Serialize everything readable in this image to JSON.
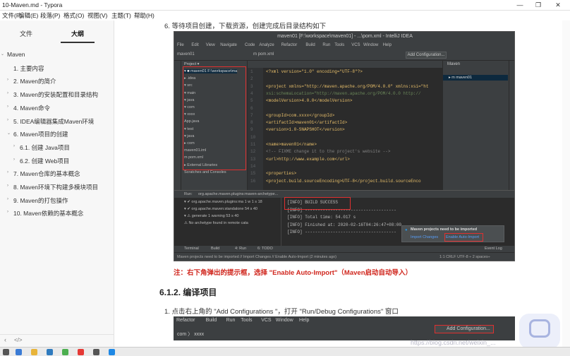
{
  "window": {
    "title": "10-Maven.md - Typora",
    "min": "—",
    "max": "❐",
    "close": "✕"
  },
  "menu": [
    "文件(F)",
    "编辑(E)",
    "段落(P)",
    "格式(O)",
    "视图(V)",
    "主题(T)",
    "帮助(H)"
  ],
  "sidebar": {
    "tab_files": "文件",
    "tab_outline": "大纲",
    "outline": [
      {
        "label": "Maven",
        "caret": "⌄",
        "level": 0
      },
      {
        "label": "1. 主要内容",
        "caret": "",
        "level": 1
      },
      {
        "label": "2. Maven的简介",
        "caret": "›",
        "level": 1
      },
      {
        "label": "3. Maven的安装配置和目录结构",
        "caret": "›",
        "level": 1
      },
      {
        "label": "4. Maven命令",
        "caret": "›",
        "level": 1
      },
      {
        "label": "5. IDEA编辑器集成Maven环境",
        "caret": "›",
        "level": 1
      },
      {
        "label": "6. Maven项目的创建",
        "caret": "⌄",
        "level": 1
      },
      {
        "label": "6.1. 创建 Java项目",
        "caret": "›",
        "level": 2
      },
      {
        "label": "6.2. 创建 Web项目",
        "caret": "›",
        "level": 2
      },
      {
        "label": "7. Maven仓库的基本概念",
        "caret": "›",
        "level": 1
      },
      {
        "label": "8. Maven环境下构建多模块项目",
        "caret": "›",
        "level": 1
      },
      {
        "label": "9. Maven的打包操作",
        "caret": "›",
        "level": 1
      },
      {
        "label": "10. Maven依赖的基本概念",
        "caret": "›",
        "level": 1
      }
    ],
    "footer_prev": "‹",
    "footer_code": "</>"
  },
  "doc": {
    "step6": "6. 等待项目创建，下载资源，创建完成后目录结构如下",
    "note": "注：右下角弹出的提示框，选择 \"Enable Auto-Import\"（Maven启动自动导入）",
    "h612": "6.1.2. 编译项目",
    "step1": "1. 点击右上角的 \"Add Configurations \"，打开 \"Run/Debug Configurations\" 窗口"
  },
  "ide": {
    "title": "maven01 [F:\\workspace\\maven01] - ...\\pom.xml - IntelliJ IDEA",
    "menu": [
      "File",
      "Edit",
      "View",
      "Navigate",
      "Code",
      "Analyze",
      "Refactor",
      "Build",
      "Run",
      "Tools",
      "VCS",
      "Window",
      "Help"
    ],
    "breadcrumb": "maven01",
    "file_tab": "m pom.xml",
    "add_config": "Add Configuration...",
    "project_label": "Project ▾",
    "tree": [
      "▾ ■ maven01  F:\\workspace\\ma",
      "  ▸ .idea",
      "  ▾ src",
      "    ▾ main",
      "      ▾ java",
      "        ▾ com",
      "          ▾ xxxx",
      "              App.java",
      "    ▾ test",
      "      ▾ java",
      "        ▸ com",
      "    maven01.iml",
      "    m pom.xml",
      "▸ External Libraries",
      "  Scratches and Consoles"
    ],
    "code": [
      {
        "t": "<?xml version=\"1.0\" encoding=\"UTF-8\"?>",
        "c": "#e8bf6a"
      },
      {
        "t": "",
        "c": "#a9b7c6"
      },
      {
        "t": "<project xmlns=\"http://maven.apache.org/POM/4.0.0\" xmlns:xsi=\"ht",
        "c": "#e8bf6a"
      },
      {
        "t": "  xsi:schemaLocation=\"http://maven.apache.org/POM/4.0.0 http://",
        "c": "#6a8759"
      },
      {
        "t": "  <modelVersion>4.0.0</modelVersion>",
        "c": "#e8bf6a"
      },
      {
        "t": "",
        "c": "#a9b7c6"
      },
      {
        "t": "  <groupId>com.xxxx</groupId>",
        "c": "#e8bf6a"
      },
      {
        "t": "  <artifactId>maven01</artifactId>",
        "c": "#e8bf6a"
      },
      {
        "t": "  <version>1.0-SNAPSHOT</version>",
        "c": "#e8bf6a"
      },
      {
        "t": "",
        "c": "#a9b7c6"
      },
      {
        "t": "  <name>maven01</name>",
        "c": "#e8bf6a"
      },
      {
        "t": "  <!-- FIXME change it to the project's website -->",
        "c": "#808080"
      },
      {
        "t": "  <url>http://www.example.com</url>",
        "c": "#e8bf6a"
      },
      {
        "t": "",
        "c": "#a9b7c6"
      },
      {
        "t": "  <properties>",
        "c": "#e8bf6a"
      },
      {
        "t": "    <project.build.sourceEncoding>UTF-8</project.build.sourceEnco",
        "c": "#e8bf6a"
      }
    ],
    "maven_title": "Maven",
    "maven_item": "▸ m maven01",
    "run_label": "Run:",
    "run_tab": "org.apache.maven.plugins:maven-archetype...",
    "run_tree": [
      "▾ ✔ org.apache.maven.plugins:ma 1 w 1 s 18",
      "  ▾ ✔ org.apache.maven:standalone 54 s 40",
      "    ▾ ⚠ generate  1 warning  53 s 40",
      "       ⚠ No archetype found in remote cata"
    ],
    "console": [
      "[INFO] BUILD SUCCESS",
      "[INFO] ------------------------------------",
      "[INFO] Total time:  54.017 s",
      "[INFO] Finished at: 2020-02-16T04:26:47+08:00",
      "[INFO] ------------------------------------"
    ],
    "popup_title": "Maven projects need to be imported",
    "popup_import": "Import Changes",
    "popup_enable": "Enable Auto-Import",
    "bottom_tabs": [
      "Terminal",
      "Build",
      "4: Run",
      "6: TODO"
    ],
    "event_log": "Event Log",
    "status_msg": "Maven projects need to be imported // Import Changes // Enable Auto-Import (2 minutes ago)",
    "status_right": "1:1   CRLF   UTF-8 ÷   2 spaces÷"
  },
  "ide2": {
    "menu": [
      "Refactor",
      "Build",
      "Run",
      "Tools",
      "VCS",
      "Window",
      "Help"
    ],
    "crumb": "com  〉 xxxx",
    "add_config": "Add Configuration..."
  },
  "watermark": "https://blog.csdn.net/weixin_..."
}
